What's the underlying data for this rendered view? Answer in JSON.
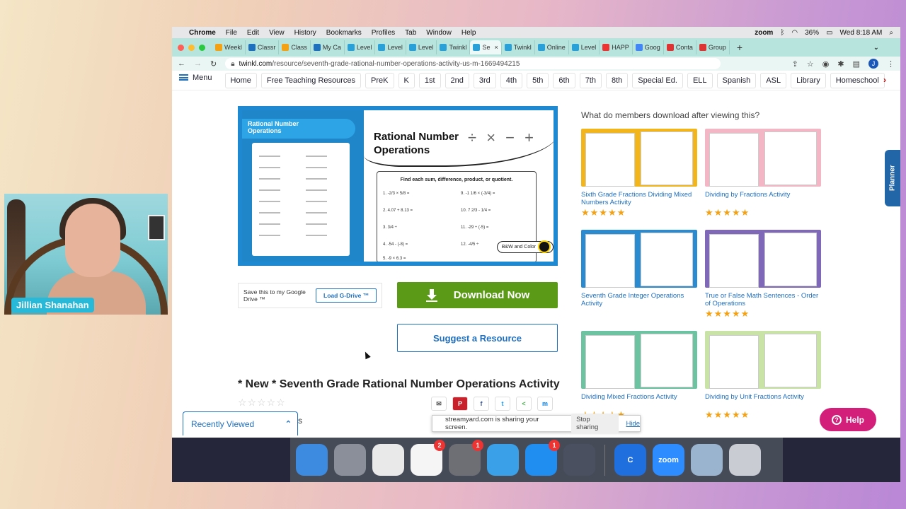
{
  "webcam": {
    "name": "Jillian Shanahan"
  },
  "menubar": {
    "app": "Chrome",
    "items": [
      "File",
      "Edit",
      "View",
      "History",
      "Bookmarks",
      "Profiles",
      "Tab",
      "Window",
      "Help"
    ],
    "right": {
      "zoom": "zoom",
      "battery": "36%",
      "clock": "Wed 8:18 AM"
    }
  },
  "tabs": [
    {
      "label": "Weekl",
      "color": "#f4a214"
    },
    {
      "label": "Classr",
      "color": "#1f6fbf"
    },
    {
      "label": "Class",
      "color": "#f4a214"
    },
    {
      "label": "My Ca",
      "color": "#1f6fbf"
    },
    {
      "label": "Level",
      "color": "#2aa0d8"
    },
    {
      "label": "Level",
      "color": "#2aa0d8"
    },
    {
      "label": "Level",
      "color": "#2aa0d8"
    },
    {
      "label": "Twinkl",
      "color": "#2aa0d8"
    },
    {
      "label": "Se",
      "color": "#2aa0d8",
      "active": true
    },
    {
      "label": "Twinkl",
      "color": "#2aa0d8"
    },
    {
      "label": "Online",
      "color": "#2aa0d8"
    },
    {
      "label": "Level",
      "color": "#2aa0d8"
    },
    {
      "label": "HAPP",
      "color": "#e33"
    },
    {
      "label": "Goog",
      "color": "#4285f4"
    },
    {
      "label": "Conta",
      "color": "#d33"
    },
    {
      "label": "Group",
      "color": "#d33"
    }
  ],
  "address": {
    "domain": "twinkl.com",
    "path": "/resource/seventh-grade-rational-number-operations-activity-us-m-1669494215",
    "avatar": "J"
  },
  "sitenav": {
    "menu_label": "Menu",
    "links": [
      "Home",
      "Free Teaching Resources",
      "PreK",
      "K",
      "1st",
      "2nd",
      "3rd",
      "4th",
      "5th",
      "6th",
      "7th",
      "8th",
      "Special Ed.",
      "ELL",
      "Spanish",
      "ASL",
      "Library",
      "Homeschool"
    ],
    "more": "›"
  },
  "preview": {
    "left_title": "Rational Number Operations",
    "big_title": "Rational Number Operations",
    "instruction": "Find each sum, difference, product, or quotient.",
    "badge": "B&W and Color",
    "symbols": "÷ × − +",
    "questions": [
      "1.  -2/3 × 5/8 =",
      "2.  4.07 + 8.13 =",
      "3.  3/4 ÷",
      "4.  -54 - (-8) =",
      "5.  -9 × 6.3 =",
      "9.  -1 1/6 × (-3/4) =",
      "10.  7 2/3 - 1/4 =",
      "11.  -29 ÷ (-5) =",
      "12.  -4/5 ÷"
    ]
  },
  "gdrive": {
    "text": "Save this to my Google Drive ™",
    "button": "Load G-Drive ™"
  },
  "download_label": "Download Now",
  "suggest_label": "Suggest a Resource",
  "resource_title": "* New * Seventh Grade Rational Number Operations Activity",
  "rating_empty": "☆☆☆☆☆",
  "share_icons": [
    "✉",
    "P",
    "f",
    "t",
    "<",
    "m"
  ],
  "recently_viewed": {
    "label": "Recently Viewed",
    "chevron": "⌃",
    "trailing": "s"
  },
  "related": {
    "title": "What do members download after viewing this?",
    "items": [
      {
        "title": "Sixth Grade Fractions Dividing Mixed Numbers Activity",
        "stars": "★★★★★",
        "bg": "#f2b51c"
      },
      {
        "title": "Dividing by Fractions Activity",
        "stars": "★★★★★",
        "bg": "#f3b6c4"
      },
      {
        "title": "Seventh Grade Integer Operations Activity",
        "stars": "",
        "bg": "#2a8bd1"
      },
      {
        "title": "True or False Math Sentences - Order of Operations",
        "stars": "★★★★★",
        "bg": "#7f68b8"
      },
      {
        "title": "Dividing Mixed Fractions Activity",
        "stars": "★★★★★",
        "bg": "#6cc3a2"
      },
      {
        "title": "Dividing by Unit Fractions Activity",
        "stars": "★★★★★",
        "bg": "#c9e2a6"
      }
    ]
  },
  "planner_label": "Planner",
  "help_label": "Help",
  "sharebar": {
    "text": "streamyard.com is sharing your screen.",
    "stop": "Stop sharing",
    "hide": "Hide"
  },
  "dock": {
    "items": [
      {
        "name": "finder",
        "color": "#3d8be0",
        "badge": ""
      },
      {
        "name": "launchpad",
        "color": "#8a8f9a",
        "badge": ""
      },
      {
        "name": "chrome",
        "color": "#e9e9e9",
        "badge": ""
      },
      {
        "name": "reminders",
        "color": "#f5f5f5",
        "badge": "2"
      },
      {
        "name": "system-preferences",
        "color": "#6d6f75",
        "badge": "1"
      },
      {
        "name": "safari",
        "color": "#3aa0e8",
        "badge": ""
      },
      {
        "name": "app-store",
        "color": "#1f8ef0",
        "badge": "1"
      },
      {
        "name": "unknown-app",
        "color": "#4a5060",
        "badge": ""
      }
    ],
    "apps2": [
      {
        "name": "classroom-teacher",
        "color": "#1f6fdf",
        "label": "C"
      },
      {
        "name": "zoom",
        "color": "#2d8cff",
        "label": "zoom"
      },
      {
        "name": "preview",
        "color": "#9ab4d0",
        "label": ""
      },
      {
        "name": "trash",
        "color": "#c9ccd2",
        "label": ""
      }
    ]
  }
}
